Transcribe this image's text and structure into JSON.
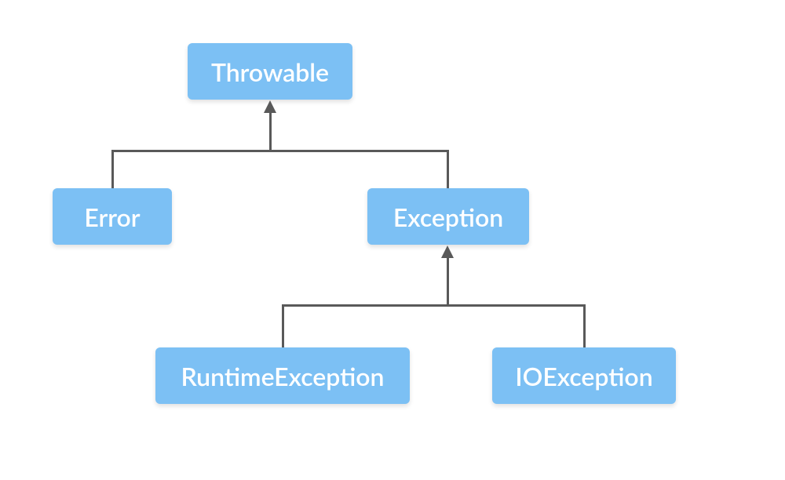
{
  "diagram": {
    "nodes": {
      "throwable": "Throwable",
      "error": "Error",
      "exception": "Exception",
      "runtimeException": "RuntimeException",
      "ioException": "IOException"
    },
    "colors": {
      "nodeBackground": "#7cc0f4",
      "nodeText": "#ffffff",
      "arrow": "#595959"
    },
    "hierarchy": {
      "root": "Throwable",
      "children": {
        "Throwable": [
          "Error",
          "Exception"
        ],
        "Exception": [
          "RuntimeException",
          "IOException"
        ]
      }
    }
  }
}
